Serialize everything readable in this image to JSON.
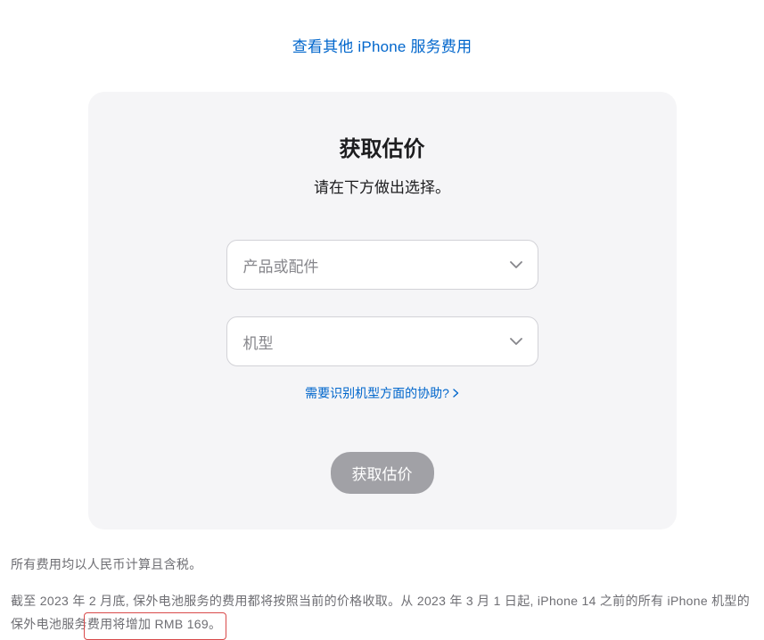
{
  "topLink": {
    "label": "查看其他 iPhone 服务费用"
  },
  "card": {
    "title": "获取估价",
    "subtitle": "请在下方做出选择。",
    "select1": {
      "placeholder": "产品或配件"
    },
    "select2": {
      "placeholder": "机型"
    },
    "helpLink": {
      "label": "需要识别机型方面的协助?"
    },
    "submit": {
      "label": "获取估价"
    }
  },
  "notes": {
    "line1": "所有费用均以人民币计算且含税。",
    "line2_pre": "截至 2023 年 2 月底, 保外电池服务的费用都将按照当前的价格收取。从 2023 年 3 月 1 日起, iPhone 14 之前的所有 iPhone 机型的保外电池服务",
    "line2_hl": "费用将增加 RMB 169。"
  }
}
